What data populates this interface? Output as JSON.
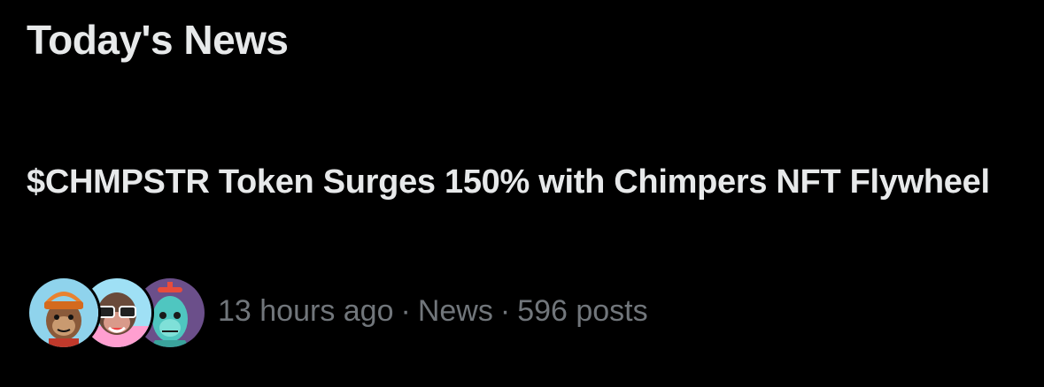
{
  "section": {
    "title": "Today's News"
  },
  "news_item": {
    "headline": "$CHMPSTR Token Surges 150% with Chimpers NFT Flywheel",
    "time": "13 hours ago",
    "separator": "·",
    "category": "News",
    "post_count": "596 posts",
    "avatars": [
      {
        "name": "ape-avatar-orange-beanie",
        "background": "#8fd3ec"
      },
      {
        "name": "ape-avatar-sunglasses",
        "background": "#ff9fd0"
      },
      {
        "name": "ape-avatar-zombie",
        "background": "#6b4f8a"
      }
    ]
  },
  "colors": {
    "background": "#000000",
    "primary_text": "#e7e9ea",
    "secondary_text": "#71767b"
  }
}
